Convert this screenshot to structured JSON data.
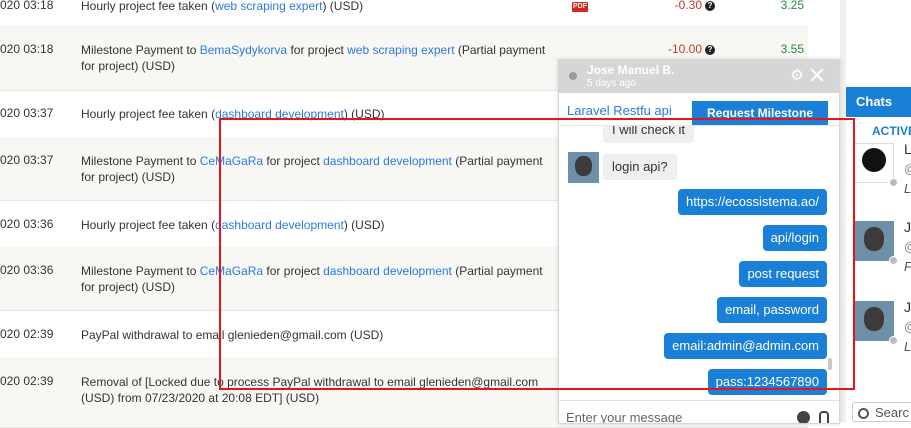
{
  "transactions": [
    {
      "date": "020 03:18",
      "pre": "Hourly project fee taken (",
      "link1": "web scraping expert",
      "mid": "",
      "link2": "",
      "post": ") (USD)",
      "pdf": "PDF",
      "amount": "-0.30",
      "balance": "3.25"
    },
    {
      "date": "020 03:18",
      "pre": "Milestone Payment to ",
      "link1": "BemaSydykorva",
      "mid": " for project ",
      "link2": "web scraping expert",
      "post": " (Partial payment for project) (USD)",
      "pdf": "",
      "amount": "-10.00",
      "balance": "3.55"
    },
    {
      "date": "020 03:37",
      "pre": "Hourly project fee taken (",
      "link1": "dashboard development",
      "mid": "",
      "link2": "",
      "post": ") (USD)",
      "pdf": "",
      "amount": "",
      "balance": ""
    },
    {
      "date": "020 03:37",
      "pre": "Milestone Payment to ",
      "link1": "CeMaGaRa",
      "mid": " for project ",
      "link2": "dashboard development",
      "post": " (Partial payment for project) (USD)",
      "pdf": "",
      "amount": "",
      "balance": ""
    },
    {
      "date": "020 03:36",
      "pre": "Hourly project fee taken (",
      "link1": "dashboard development",
      "mid": "",
      "link2": "",
      "post": ") (USD)",
      "pdf": "",
      "amount": "",
      "balance": ""
    },
    {
      "date": "020 03:36",
      "pre": "Milestone Payment to ",
      "link1": "CeMaGaRa",
      "mid": " for project ",
      "link2": "dashboard development",
      "post": " (Partial payment for project) (USD)",
      "pdf": "",
      "amount": "",
      "balance": ""
    },
    {
      "date": "020 02:39",
      "pre": "PayPal withdrawal to email glenieden@gmail.com (USD)",
      "link1": "",
      "mid": "",
      "link2": "",
      "post": "",
      "pdf": "",
      "amount": "",
      "balance": ""
    },
    {
      "date": "020 02:39",
      "pre": "Removal of [Locked due to process PayPal withdrawal to email glenieden@gmail.com (USD) from 07/23/2020 at 20:08 EDT] (USD)",
      "link1": "",
      "mid": "",
      "link2": "",
      "post": "",
      "pdf": "",
      "amount": "",
      "balance": ""
    }
  ],
  "chat": {
    "contact_name": "Jose Manuel B.",
    "last_seen": "5 days ago",
    "project_link": "Laravel Restfu api",
    "request_milestone_label": "Request Milestone",
    "messages": [
      {
        "dir": "in",
        "text": "I will check it"
      },
      {
        "dir": "in",
        "text": "login api?"
      },
      {
        "dir": "out",
        "text": "https://ecossistema.ao/"
      },
      {
        "dir": "out",
        "text": "api/login"
      },
      {
        "dir": "out",
        "text": "post request"
      },
      {
        "dir": "out",
        "text": "email, password"
      },
      {
        "dir": "out",
        "text": "email:admin@admin.com"
      },
      {
        "dir": "out",
        "text": "pass:1234567890"
      }
    ],
    "input_placeholder": "Enter your message",
    "icons": [
      "settings-icon",
      "close-icon",
      "emoji-icon",
      "attach-icon"
    ]
  },
  "panel": {
    "chats_label": "Chats",
    "active_label": "ACTIVE",
    "contacts": [
      {
        "initial": "L",
        "line2": "@",
        "line3": "L",
        "type": "logo"
      },
      {
        "initial": "J",
        "line2": "@",
        "line3": "F",
        "type": "person"
      },
      {
        "initial": "J",
        "line2": "@",
        "line3": "L",
        "type": "person"
      }
    ],
    "search_label": "Searc"
  },
  "colors": {
    "accent": "#1a7fd7",
    "highlight": "#e8141b",
    "negative": "#c0392b",
    "positive": "#2b8a3e",
    "link": "#2a7ae2"
  }
}
